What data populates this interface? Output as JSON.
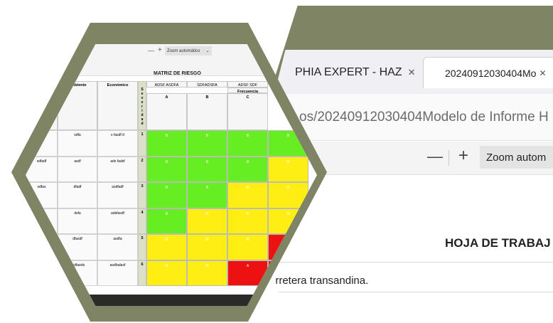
{
  "browser": {
    "tabs": [
      {
        "label": "PHIA EXPERT - HAZ",
        "close": "✕"
      },
      {
        "label": "20240912030404Mo",
        "close": "✕"
      }
    ],
    "url": "os/20240912030404Modelo de Informe H",
    "toolbar": {
      "minus": "—",
      "plus": "+",
      "zoom": "Zoom autom"
    },
    "document": {
      "title": "HOJA DE TRABAJ",
      "line": "arretera transandina."
    }
  },
  "sheet": {
    "toolbar": {
      "minus": "—",
      "plus": "+",
      "zoom": "Zoom automático",
      "chevron": "⌄"
    },
    "title": "MATRIZ DE RIESGO",
    "top_headers": [
      "ADSF ASDFA",
      "SDFADSFA",
      "ADSF SDF"
    ],
    "frecuencia_label": "Frecuencia",
    "freq_letters": [
      "A",
      "B",
      "C"
    ],
    "impact_headers": [
      "Ambiente",
      "Económico"
    ],
    "severidad_letters": "S e v e r i d a d",
    "rows": [
      {
        "left": "",
        "ambiente": "sdfa",
        "economico": "s fasdf d",
        "sev": "1"
      },
      {
        "left": "sdfadf",
        "ambiente": "asdf",
        "economico": "ads fadsf",
        "sev": "2"
      },
      {
        "left": "sdfas",
        "ambiente": "dfadf",
        "economico": "asdfadf",
        "sev": "3"
      },
      {
        "left": "",
        "ambiente": "dsfa",
        "economico": "adsfasdf",
        "sev": "4"
      },
      {
        "left": "",
        "ambiente": "dfasdf",
        "economico": "asdfa",
        "sev": "5"
      },
      {
        "left": "",
        "ambiente": "asdfaeds",
        "economico": "asdfadasf",
        "sev": "6"
      }
    ],
    "cell_labels": {
      "green": "B",
      "yellow": "M",
      "red": "A"
    },
    "colors": {
      "green": "#66ee22",
      "yellow": "#ffee11",
      "red": "#ee1111",
      "frame": "#7f8465"
    }
  }
}
